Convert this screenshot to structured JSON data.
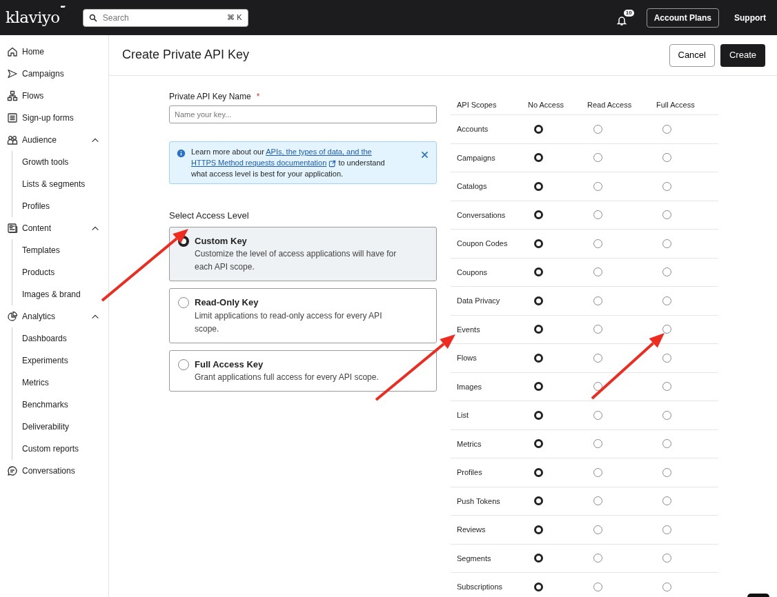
{
  "topbar": {
    "logo": "klaviyo",
    "search": {
      "placeholder": "Search",
      "shortcut": "⌘ K"
    },
    "notifications": "10",
    "buttons": [
      "Account Plans"
    ],
    "link": "Support"
  },
  "sidebar": {
    "items": [
      {
        "label": "Home"
      },
      {
        "label": "Campaigns"
      },
      {
        "label": "Flows"
      },
      {
        "label": "Sign-up forms"
      },
      {
        "label": "Audience",
        "expanded": true,
        "children": [
          {
            "label": "Growth tools"
          },
          {
            "label": "Lists & segments"
          },
          {
            "label": "Profiles"
          }
        ]
      },
      {
        "label": "Content",
        "expanded": true,
        "children": [
          {
            "label": "Templates"
          },
          {
            "label": "Products"
          },
          {
            "label": "Images & brand"
          }
        ]
      },
      {
        "label": "Analytics",
        "expanded": true,
        "children": [
          {
            "label": "Dashboards"
          },
          {
            "label": "Experiments"
          },
          {
            "label": "Metrics"
          },
          {
            "label": "Benchmarks"
          },
          {
            "label": "Deliverability"
          },
          {
            "label": "Custom reports"
          }
        ]
      },
      {
        "label": "Conversations"
      }
    ]
  },
  "header": {
    "title": "Create Private API Key",
    "cancel": "Cancel",
    "create": "Create"
  },
  "form": {
    "name_label": "Private API Key Name",
    "required_mark": "*",
    "name_field": {
      "placeholder": "Name your key..."
    },
    "info": {
      "before": "Learn more about our",
      "link_lines": [
        "APIs, the types of data, and the",
        "HTTPS Method requests documentation"
      ],
      "after_lines": [
        "to understand",
        "what access level is best for your application."
      ]
    },
    "access_label": "Select Access Level",
    "access_options": [
      {
        "title": "Custom Key",
        "description": "Customize the level of access applications will have for each API scope.",
        "selected": true
      },
      {
        "title": "Read-Only Key",
        "description": "Limit applications to read-only access for every API scope.",
        "selected": false
      },
      {
        "title": "Full Access Key",
        "description": "Grant applications full access for every API scope.",
        "selected": false
      }
    ]
  },
  "scopes": {
    "columns": [
      "API Scopes",
      "No Access",
      "Read Access",
      "Full Access"
    ],
    "rows": [
      {
        "name": "Accounts",
        "options": [
          {
            "selected": true
          },
          {
            "selected": false
          },
          {
            "selected": false
          }
        ]
      },
      {
        "name": "Campaigns",
        "options": [
          {
            "selected": true
          },
          {
            "selected": false
          },
          {
            "selected": false
          }
        ]
      },
      {
        "name": "Catalogs",
        "options": [
          {
            "selected": true
          },
          {
            "selected": false
          },
          {
            "selected": false
          }
        ]
      },
      {
        "name": "Conversations",
        "options": [
          {
            "selected": true
          },
          {
            "selected": false
          },
          {
            "selected": false
          }
        ]
      },
      {
        "name": "Coupon Codes",
        "options": [
          {
            "selected": true
          },
          {
            "selected": false
          },
          {
            "selected": false
          }
        ]
      },
      {
        "name": "Coupons",
        "options": [
          {
            "selected": true
          },
          {
            "selected": false
          },
          {
            "selected": false
          }
        ]
      },
      {
        "name": "Data Privacy",
        "options": [
          {
            "selected": true
          },
          {
            "selected": false
          },
          {
            "selected": false
          }
        ]
      },
      {
        "name": "Events",
        "options": [
          {
            "selected": true
          },
          {
            "selected": false
          },
          {
            "selected": false
          }
        ]
      },
      {
        "name": "Flows",
        "options": [
          {
            "selected": true
          },
          {
            "selected": false
          },
          {
            "selected": false
          }
        ]
      },
      {
        "name": "Images",
        "options": [
          {
            "selected": true
          },
          {
            "selected": false
          },
          {
            "selected": false
          }
        ]
      },
      {
        "name": "List",
        "options": [
          {
            "selected": true
          },
          {
            "selected": false
          },
          {
            "selected": false
          }
        ]
      },
      {
        "name": "Metrics",
        "options": [
          {
            "selected": true
          },
          {
            "selected": false
          },
          {
            "selected": false
          }
        ]
      },
      {
        "name": "Profiles",
        "options": [
          {
            "selected": true
          },
          {
            "selected": false
          },
          {
            "selected": false
          }
        ]
      },
      {
        "name": "Push Tokens",
        "options": [
          {
            "selected": true
          },
          {
            "selected": false
          },
          {
            "selected": false
          }
        ]
      },
      {
        "name": "Reviews",
        "options": [
          {
            "selected": true
          },
          {
            "selected": false
          },
          {
            "selected": false
          }
        ]
      },
      {
        "name": "Segments",
        "options": [
          {
            "selected": true
          },
          {
            "selected": false
          },
          {
            "selected": false
          }
        ]
      },
      {
        "name": "Subscriptions",
        "options": [
          {
            "selected": true
          },
          {
            "selected": false
          },
          {
            "selected": false
          }
        ]
      }
    ]
  }
}
